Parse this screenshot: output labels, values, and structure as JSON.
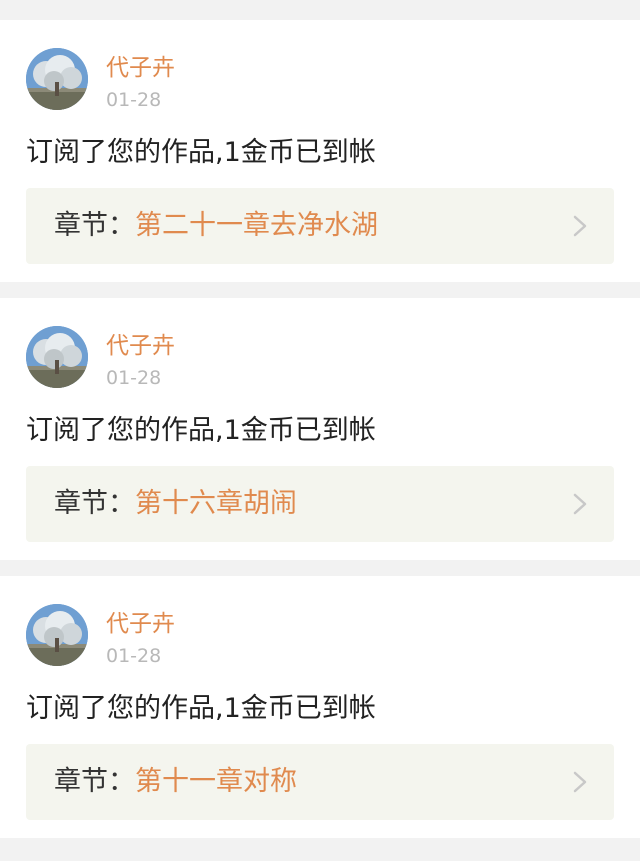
{
  "colors": {
    "page_background": "#f2f2f2",
    "card_background": "#ffffff",
    "accent_orange": "#e08a4e",
    "date_gray": "#b8b8b8",
    "chapter_box_background": "#f4f5ee",
    "chevron_gray": "#c8c8c8"
  },
  "notifications": [
    {
      "username": "代子卉",
      "date": "01-28",
      "message": "订阅了您的作品,1金币已到帐",
      "chapter_prefix": "章节：",
      "chapter_title": "第二十一章去净水湖",
      "avatar_icon": "tree-photo-avatar",
      "link_icon": "chevron-right-icon"
    },
    {
      "username": "代子卉",
      "date": "01-28",
      "message": "订阅了您的作品,1金币已到帐",
      "chapter_prefix": "章节：",
      "chapter_title": "第十六章胡闹",
      "avatar_icon": "tree-photo-avatar",
      "link_icon": "chevron-right-icon"
    },
    {
      "username": "代子卉",
      "date": "01-28",
      "message": "订阅了您的作品,1金币已到帐",
      "chapter_prefix": "章节：",
      "chapter_title": "第十一章对称",
      "avatar_icon": "tree-photo-avatar",
      "link_icon": "chevron-right-icon"
    }
  ]
}
